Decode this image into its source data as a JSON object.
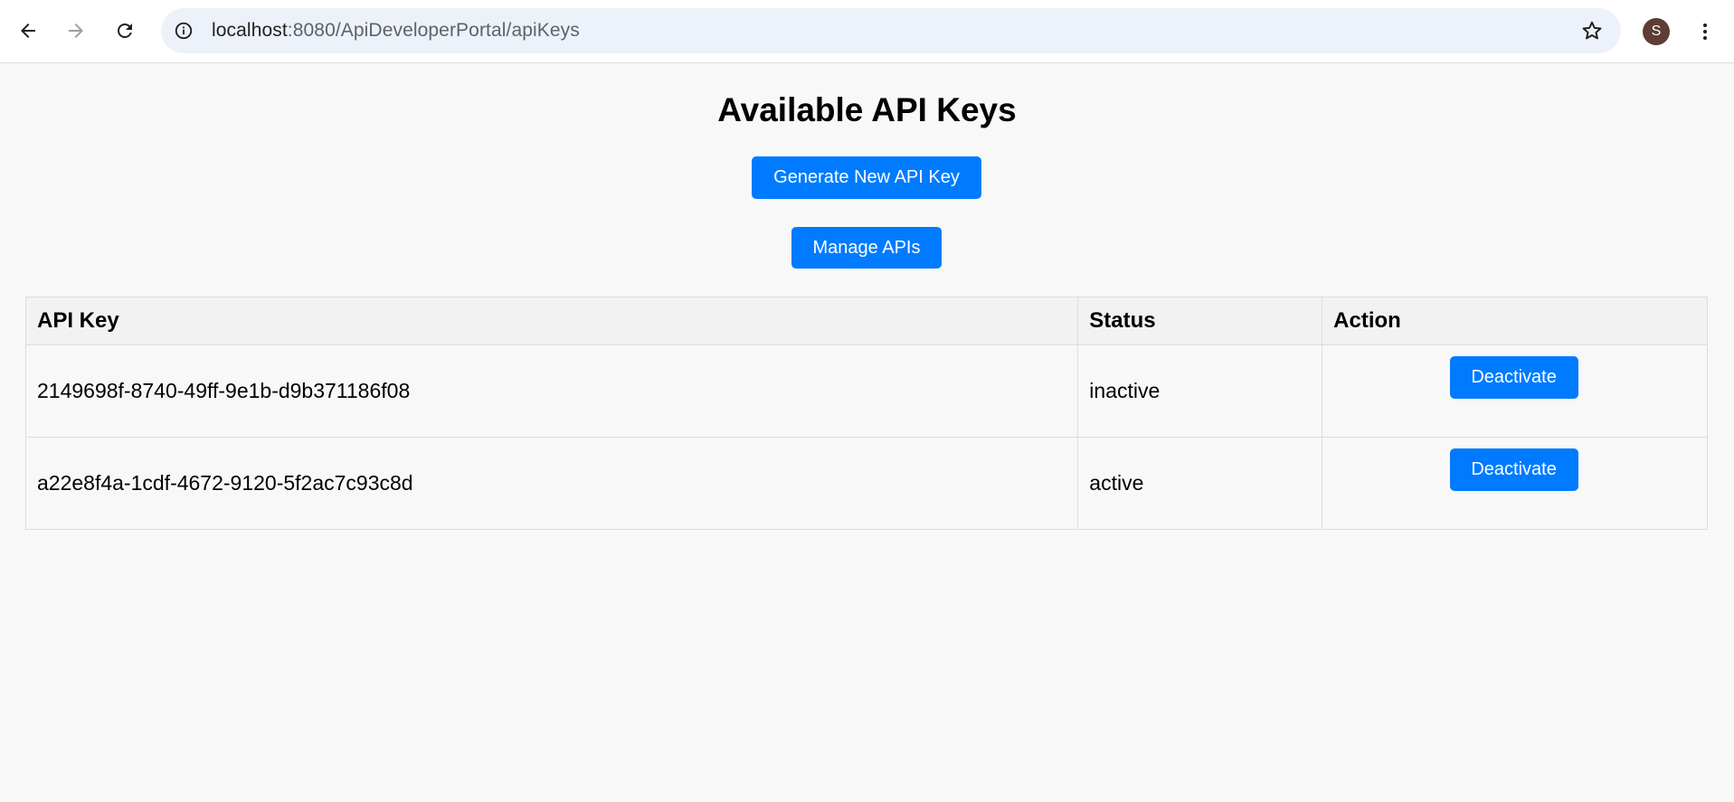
{
  "browser": {
    "url_host": "localhost",
    "url_path": ":8080/ApiDeveloperPortal/apiKeys",
    "profile_initial": "S"
  },
  "page": {
    "title": "Available API Keys",
    "generate_button": "Generate New API Key",
    "manage_button": "Manage APIs"
  },
  "table": {
    "headers": [
      "API Key",
      "Status",
      "Action"
    ],
    "rows": [
      {
        "key": "2149698f-8740-49ff-9e1b-d9b371186f08",
        "status": "inactive",
        "action": "Deactivate"
      },
      {
        "key": "a22e8f4a-1cdf-4672-9120-5f2ac7c93c8d",
        "status": "active",
        "action": "Deactivate"
      }
    ]
  },
  "colors": {
    "accent": "#007bff",
    "page_bg": "#f8f8f8",
    "header_bg": "#f2f2f2"
  }
}
